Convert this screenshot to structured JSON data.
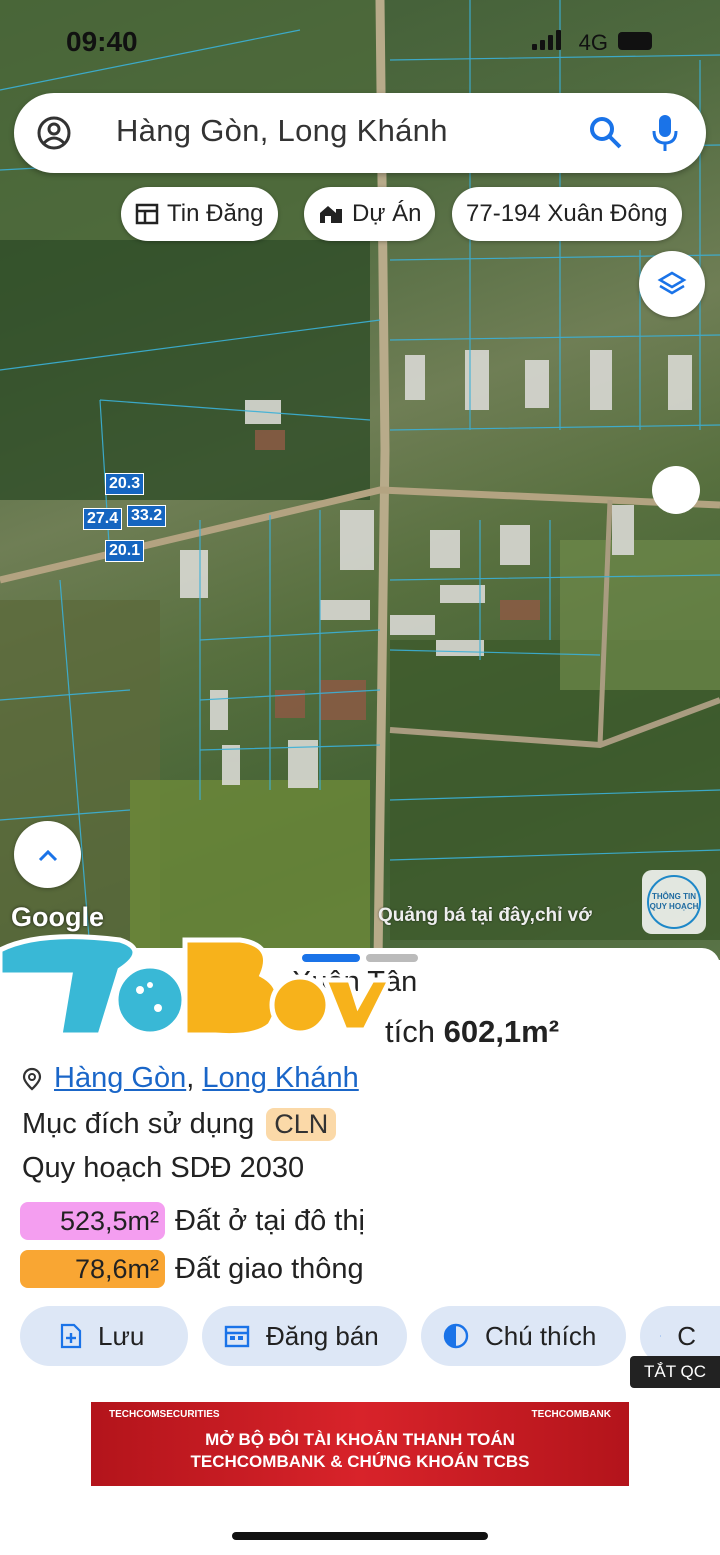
{
  "status": {
    "time": "09:40",
    "network": "4G"
  },
  "search": {
    "query": "Hàng Gòn, Long Khánh"
  },
  "chips": [
    {
      "label": "Tin Đăng",
      "icon": "listing-icon"
    },
    {
      "label": "Dự Án",
      "icon": "house-icon"
    },
    {
      "label": "77-194 Xuân Đông",
      "icon": ""
    }
  ],
  "map": {
    "measurements": [
      "20.3",
      "27.4",
      "33.2",
      "20.1"
    ],
    "google_label": "Google",
    "ad_text": "Quảng bá tại đây,chỉ vớ",
    "plan_badge": "THÔNG TIN QUY HOẠCH"
  },
  "sticker_text": "ThiBay",
  "sheet": {
    "address": "Xuân Tân",
    "parcel_prefix": "tích",
    "parcel_area": "602,1m²",
    "location": {
      "ward": "Hàng Gòn",
      "city": "Long Khánh",
      "separator": ", "
    },
    "purpose_label": "Mục đích sử dụng",
    "purpose_code": "CLN",
    "plan_title": "Quy hoạch SDĐ 2030",
    "zones": [
      {
        "area": "523,5m²",
        "label": "Đất ở tại đô thị",
        "color": "#f49ef0"
      },
      {
        "area": "78,6m²",
        "label": "Đất giao thông",
        "color": "#f9a633"
      }
    ],
    "actions": [
      {
        "label": "Lưu",
        "icon": "add-file-icon"
      },
      {
        "label": "Đăng bán",
        "icon": "calendar-icon"
      },
      {
        "label": "Chú thích",
        "icon": "contrast-icon"
      },
      {
        "label": "C",
        "icon": "camera-icon"
      }
    ],
    "hide_ads": "TẮT QC",
    "banner": {
      "brand_left": "TECHCOMSECURITIES",
      "brand_right": "TECHCOMBANK",
      "line1": "MỞ BỘ ĐÔI TÀI KHOẢN THANH TOÁN",
      "line2": "TECHCOMBANK & CHỨNG KHOÁN TCBS"
    }
  }
}
